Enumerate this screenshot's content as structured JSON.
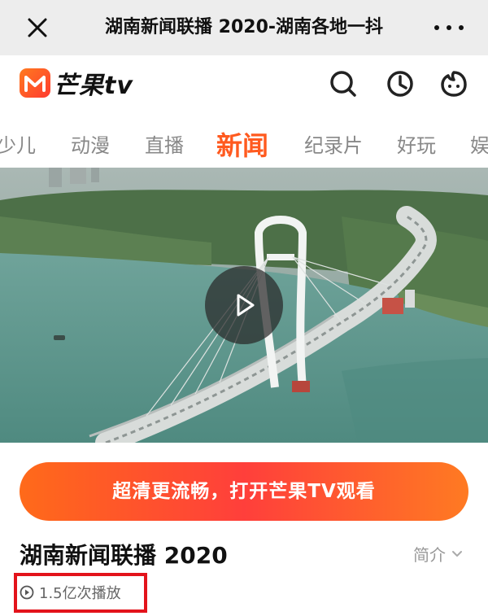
{
  "topbar": {
    "title": "湖南新闻联播 2020-湖南各地一抖",
    "close_icon": "close-icon",
    "more_icon": "more-icon"
  },
  "brand": {
    "logo_text": "芒果tv",
    "brand_color": "#ff5a1f",
    "icons": [
      "search-icon",
      "history-icon",
      "user-icon"
    ]
  },
  "tabs": [
    {
      "label": "少儿"
    },
    {
      "label": "动漫"
    },
    {
      "label": "直播"
    },
    {
      "label": "新闻",
      "active": true
    },
    {
      "label": "纪录片"
    },
    {
      "label": "好玩"
    },
    {
      "label": "娱"
    }
  ],
  "video": {
    "play_icon": "play-icon"
  },
  "cta": {
    "label": "超清更流畅，打开芒果TV观看"
  },
  "program": {
    "title": "湖南新闻联播 2020",
    "intro_label": "简介",
    "play_count": "1.5亿次播放"
  }
}
